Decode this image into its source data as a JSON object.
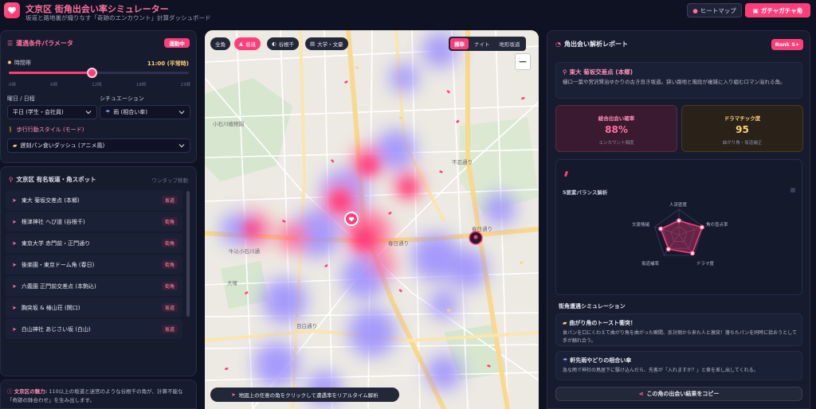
{
  "header": {
    "title": "文京区 街角出会い率シミュレーター",
    "subtitle": "坂道と路地裏が織りなす「奇跡のエンカウント」計算ダッシュボード",
    "heatmap_button": "ヒートマップ",
    "gacha_button": "ガチャガチャ角"
  },
  "params": {
    "title": "遭遇条件パラメータ",
    "status_badge": "運動中",
    "time_label": "時間帯",
    "time_value": "11:00 (平常時)",
    "time_slider_fraction": 0.458,
    "ticks": [
      "0時",
      "6時",
      "12時",
      "18時",
      "23時"
    ],
    "day_label": "曜日 / 日程",
    "day_value": "平日 (学生・会社員)",
    "situation_label": "シチュエーション",
    "situation_value": "雨 (相合い傘)",
    "style_label": "歩行行動スタイル (モード)",
    "style_value": "遅刻パン食いダッシュ (アニメ風)"
  },
  "spots": {
    "title": "文京区 有名坂道・角スポット",
    "hint": "ワンタップ移動",
    "items": [
      {
        "name": "東大 菊坂交差点 (本郷)",
        "tag": "坂道"
      },
      {
        "name": "根津神社 へび道 (谷根千)",
        "tag": "街角"
      },
      {
        "name": "東京大学 赤門前・正門通り",
        "tag": "街角"
      },
      {
        "name": "後楽園・東京ドーム角 (春日)",
        "tag": "街角"
      },
      {
        "name": "六義園 正門前交差点 (本駒込)",
        "tag": "街角"
      },
      {
        "name": "胸突坂 & 椿山荘 (関口)",
        "tag": "坂道"
      },
      {
        "name": "白山神社 あじさい坂 (白山)",
        "tag": "坂道"
      }
    ]
  },
  "footer": {
    "lead": "文京区の魅力:",
    "text": "110以上の坂道と迷宮のような谷根千の角が、計算不能な「奇跡の鉢合わせ」を生み出します。"
  },
  "map": {
    "chips": [
      {
        "label": "全角",
        "active": false
      },
      {
        "label": "坂道",
        "active": true
      },
      {
        "label": "谷根千",
        "active": false
      },
      {
        "label": "大学・文豪",
        "active": false
      }
    ],
    "modes": [
      "標準",
      "ナイト",
      "地形坂道"
    ],
    "active_mode": "標準",
    "zoom_out": "−",
    "banner": "地図上の任意の角をクリックして遭遇率をリアルタイム解析",
    "labels": {
      "l1": "小石川植物園",
      "l2": "春日通り",
      "l3": "春日通り",
      "l4": "牛込小石川通",
      "l5": "目白通り",
      "l6": "本郷通り",
      "l7": "不忍通り",
      "l8": "大塚"
    }
  },
  "report": {
    "title": "角出会い解析レポート",
    "rank": "Rank S+",
    "location_name": "東大 菊坂交差点 (本郷)",
    "location_desc": "樋口一葉や宮沢賢治ゆかりの古き良き坂道。狭い路地と階段が複雑に入り組むロマン溢れる角。",
    "stat1_label": "総合出会い確率",
    "stat1_value": "88%",
    "stat1_sub": "エンカウント頻度",
    "stat2_label": "ドラマチック度",
    "stat2_value": "95",
    "stat2_sub": "曲がり角・坂道補正",
    "radar_title": "5要素バランス解析",
    "radar_axes": [
      "人流密度",
      "角の盲点率",
      "ドラマ度",
      "坂道補率",
      "文豪情緒"
    ],
    "radar_values": [
      0.55,
      0.95,
      0.9,
      0.7,
      0.75
    ],
    "sim_title": "街角遭遇シミュレーション",
    "sim1_head": "曲がり角のトースト衝突！",
    "sim1_body": "食パンを口にくわえて曲がり角を曲がった瞬間、反対側から来た人と激突！落ちたパンを同時に拾おうとして手が触れ合う。",
    "sim2_head": "軒先雨やどりの相合い傘",
    "sim2_body": "急な雨で神社の鳥居下に駆け込んだら、先客が「入れますか？」と傘を差し出してくれる。",
    "copy_button": "この角の出会い結果をコピー"
  },
  "colors": {
    "accent": "#ff3d7a",
    "background": "#0e1222",
    "panel": "#161b2e"
  }
}
